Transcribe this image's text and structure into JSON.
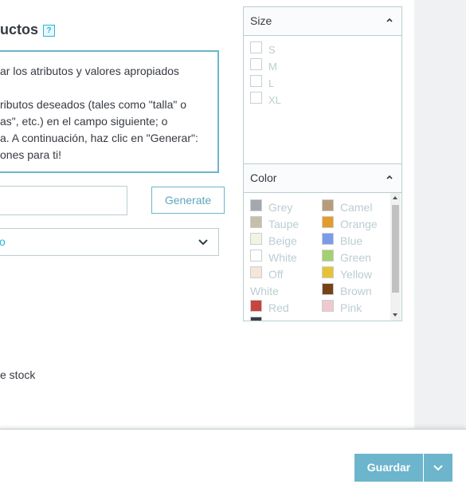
{
  "main": {
    "section_title": "uctos",
    "help_icon": "?",
    "info_lines": [
      "ar los atributos y valores apropiados",
      "",
      "ributos deseados (tales como \"talla\" o",
      "as\", etc.) en el campo siguiente; o",
      "a. A continuación, haz clic en \"Generar\":",
      "ones para ti!"
    ],
    "attribute_input_value": "",
    "generate_label": "Generate",
    "select_value": "o",
    "stock_label": "e stock"
  },
  "size_panel": {
    "title": "Size",
    "items": [
      "S",
      "M",
      "L",
      "XL"
    ]
  },
  "color_panel": {
    "title": "Color",
    "left_column": [
      {
        "label": "Grey",
        "color": "#a2a8ae"
      },
      {
        "label": "Taupe",
        "color": "#c7bfa8"
      },
      {
        "label": "Beige",
        "color": "#f1f5df"
      },
      {
        "label": "White",
        "color": "#ffffff"
      },
      {
        "label": "Off",
        "color": "#f5e6d8"
      },
      {
        "label": "White",
        "color": null
      },
      {
        "label": "Red",
        "color": "#c7453c"
      },
      {
        "label": "",
        "color": "#3a3f44"
      }
    ],
    "right_column": [
      {
        "label": "Camel",
        "color": "#b89c79"
      },
      {
        "label": "Orange",
        "color": "#e59a2c"
      },
      {
        "label": "Blue",
        "color": "#7b9ae9"
      },
      {
        "label": "Green",
        "color": "#a3d071"
      },
      {
        "label": "Yellow",
        "color": "#e7c234"
      },
      {
        "label": "Brown",
        "color": "#784218"
      },
      {
        "label": "Pink",
        "color": "#f1c8d0"
      }
    ]
  },
  "footer": {
    "save_label": "Guardar",
    "save_menu_icon": "chevron-down-icon"
  },
  "colors": {
    "accent": "#6cb5cc",
    "link": "#25b9d7",
    "text": "#363a41",
    "muted": "#bbcdd2"
  }
}
